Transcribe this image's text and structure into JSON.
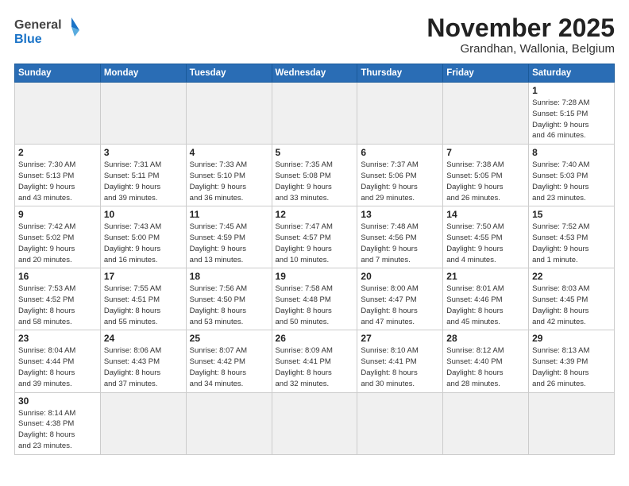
{
  "header": {
    "logo_general": "General",
    "logo_blue": "Blue",
    "title": "November 2025",
    "subtitle": "Grandhan, Wallonia, Belgium"
  },
  "days_of_week": [
    "Sunday",
    "Monday",
    "Tuesday",
    "Wednesday",
    "Thursday",
    "Friday",
    "Saturday"
  ],
  "weeks": [
    [
      {
        "day": "",
        "info": ""
      },
      {
        "day": "",
        "info": ""
      },
      {
        "day": "",
        "info": ""
      },
      {
        "day": "",
        "info": ""
      },
      {
        "day": "",
        "info": ""
      },
      {
        "day": "",
        "info": ""
      },
      {
        "day": "1",
        "info": "Sunrise: 7:28 AM\nSunset: 5:15 PM\nDaylight: 9 hours\nand 46 minutes."
      }
    ],
    [
      {
        "day": "2",
        "info": "Sunrise: 7:30 AM\nSunset: 5:13 PM\nDaylight: 9 hours\nand 43 minutes."
      },
      {
        "day": "3",
        "info": "Sunrise: 7:31 AM\nSunset: 5:11 PM\nDaylight: 9 hours\nand 39 minutes."
      },
      {
        "day": "4",
        "info": "Sunrise: 7:33 AM\nSunset: 5:10 PM\nDaylight: 9 hours\nand 36 minutes."
      },
      {
        "day": "5",
        "info": "Sunrise: 7:35 AM\nSunset: 5:08 PM\nDaylight: 9 hours\nand 33 minutes."
      },
      {
        "day": "6",
        "info": "Sunrise: 7:37 AM\nSunset: 5:06 PM\nDaylight: 9 hours\nand 29 minutes."
      },
      {
        "day": "7",
        "info": "Sunrise: 7:38 AM\nSunset: 5:05 PM\nDaylight: 9 hours\nand 26 minutes."
      },
      {
        "day": "8",
        "info": "Sunrise: 7:40 AM\nSunset: 5:03 PM\nDaylight: 9 hours\nand 23 minutes."
      }
    ],
    [
      {
        "day": "9",
        "info": "Sunrise: 7:42 AM\nSunset: 5:02 PM\nDaylight: 9 hours\nand 20 minutes."
      },
      {
        "day": "10",
        "info": "Sunrise: 7:43 AM\nSunset: 5:00 PM\nDaylight: 9 hours\nand 16 minutes."
      },
      {
        "day": "11",
        "info": "Sunrise: 7:45 AM\nSunset: 4:59 PM\nDaylight: 9 hours\nand 13 minutes."
      },
      {
        "day": "12",
        "info": "Sunrise: 7:47 AM\nSunset: 4:57 PM\nDaylight: 9 hours\nand 10 minutes."
      },
      {
        "day": "13",
        "info": "Sunrise: 7:48 AM\nSunset: 4:56 PM\nDaylight: 9 hours\nand 7 minutes."
      },
      {
        "day": "14",
        "info": "Sunrise: 7:50 AM\nSunset: 4:55 PM\nDaylight: 9 hours\nand 4 minutes."
      },
      {
        "day": "15",
        "info": "Sunrise: 7:52 AM\nSunset: 4:53 PM\nDaylight: 9 hours\nand 1 minute."
      }
    ],
    [
      {
        "day": "16",
        "info": "Sunrise: 7:53 AM\nSunset: 4:52 PM\nDaylight: 8 hours\nand 58 minutes."
      },
      {
        "day": "17",
        "info": "Sunrise: 7:55 AM\nSunset: 4:51 PM\nDaylight: 8 hours\nand 55 minutes."
      },
      {
        "day": "18",
        "info": "Sunrise: 7:56 AM\nSunset: 4:50 PM\nDaylight: 8 hours\nand 53 minutes."
      },
      {
        "day": "19",
        "info": "Sunrise: 7:58 AM\nSunset: 4:48 PM\nDaylight: 8 hours\nand 50 minutes."
      },
      {
        "day": "20",
        "info": "Sunrise: 8:00 AM\nSunset: 4:47 PM\nDaylight: 8 hours\nand 47 minutes."
      },
      {
        "day": "21",
        "info": "Sunrise: 8:01 AM\nSunset: 4:46 PM\nDaylight: 8 hours\nand 45 minutes."
      },
      {
        "day": "22",
        "info": "Sunrise: 8:03 AM\nSunset: 4:45 PM\nDaylight: 8 hours\nand 42 minutes."
      }
    ],
    [
      {
        "day": "23",
        "info": "Sunrise: 8:04 AM\nSunset: 4:44 PM\nDaylight: 8 hours\nand 39 minutes."
      },
      {
        "day": "24",
        "info": "Sunrise: 8:06 AM\nSunset: 4:43 PM\nDaylight: 8 hours\nand 37 minutes."
      },
      {
        "day": "25",
        "info": "Sunrise: 8:07 AM\nSunset: 4:42 PM\nDaylight: 8 hours\nand 34 minutes."
      },
      {
        "day": "26",
        "info": "Sunrise: 8:09 AM\nSunset: 4:41 PM\nDaylight: 8 hours\nand 32 minutes."
      },
      {
        "day": "27",
        "info": "Sunrise: 8:10 AM\nSunset: 4:41 PM\nDaylight: 8 hours\nand 30 minutes."
      },
      {
        "day": "28",
        "info": "Sunrise: 8:12 AM\nSunset: 4:40 PM\nDaylight: 8 hours\nand 28 minutes."
      },
      {
        "day": "29",
        "info": "Sunrise: 8:13 AM\nSunset: 4:39 PM\nDaylight: 8 hours\nand 26 minutes."
      }
    ],
    [
      {
        "day": "30",
        "info": "Sunrise: 8:14 AM\nSunset: 4:38 PM\nDaylight: 8 hours\nand 23 minutes."
      },
      {
        "day": "",
        "info": ""
      },
      {
        "day": "",
        "info": ""
      },
      {
        "day": "",
        "info": ""
      },
      {
        "day": "",
        "info": ""
      },
      {
        "day": "",
        "info": ""
      },
      {
        "day": "",
        "info": ""
      }
    ]
  ]
}
